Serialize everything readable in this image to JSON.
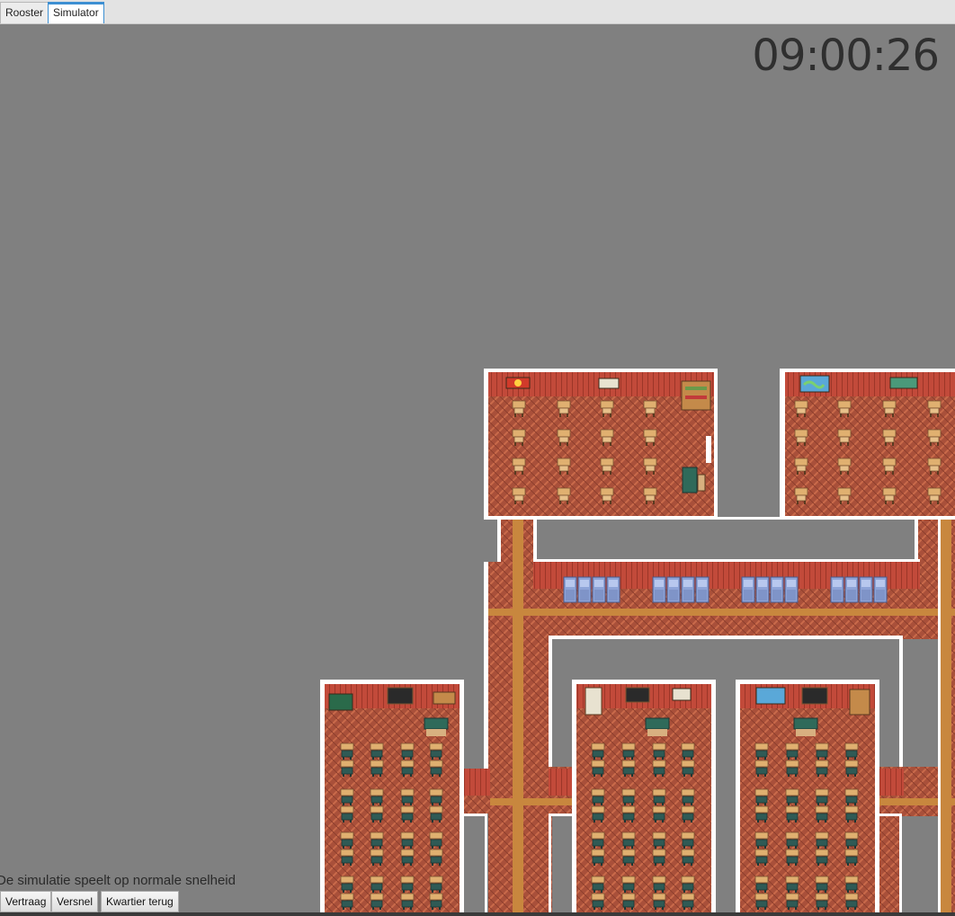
{
  "tabs": [
    {
      "label": "Rooster",
      "active": false
    },
    {
      "label": "Simulator",
      "active": true
    }
  ],
  "clock": "09:00:26",
  "status_text": "De simulatie speelt op normale snelheid",
  "controls": {
    "slow_down": "Vertraag",
    "speed_up": "Versnel",
    "quarter_back": "Kwartier terug"
  },
  "colors": {
    "background": "#808080",
    "floor": "#a9503a",
    "wall": "#c24a3a",
    "corridor_stripe": "#c8873e",
    "border": "#ffffff",
    "accent": "#3c8fd2"
  }
}
